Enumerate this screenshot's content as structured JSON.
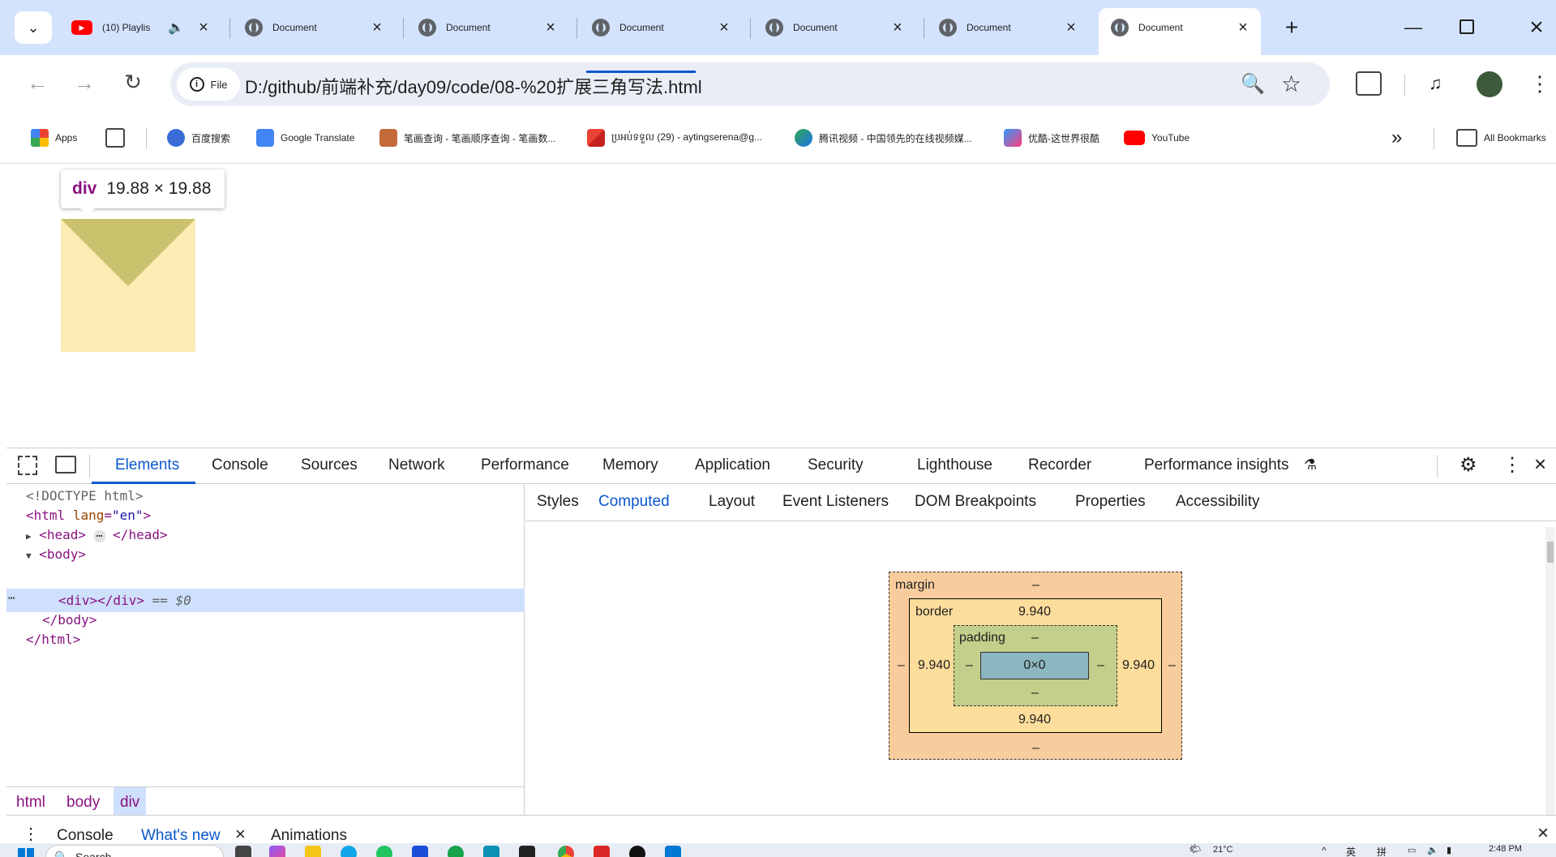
{
  "tabs": [
    {
      "title": "(10) Playlis",
      "icon": "youtube-icon"
    },
    {
      "title": "Document",
      "icon": "globe-icon"
    },
    {
      "title": "Document",
      "icon": "globe-icon"
    },
    {
      "title": "Document",
      "icon": "globe-icon"
    },
    {
      "title": "Document",
      "icon": "globe-icon"
    },
    {
      "title": "Document",
      "icon": "globe-icon"
    },
    {
      "title": "Document",
      "icon": "globe-icon",
      "active": true
    }
  ],
  "toolbar": {
    "file_chip": "File",
    "url": "D:/github/前端补充/day09/code/08-%20扩展三角写法.html"
  },
  "bookmarks": [
    {
      "label": "Apps"
    },
    {
      "label": "百度搜索"
    },
    {
      "label": "Google Translate"
    },
    {
      "label": "笔画查询 - 笔画顺序查询 - 笔画数..."
    },
    {
      "label": "ប្រអប់ទទួល (29) - aytingserena@g..."
    },
    {
      "label": "腾讯视频 - 中国领先的在线视频媒..."
    },
    {
      "label": "优酷-这世界很酷"
    },
    {
      "label": "YouTube"
    },
    {
      "label": "All Bookmarks"
    }
  ],
  "page": {
    "tooltip_tag": "div",
    "tooltip_size": "19.88 × 19.88"
  },
  "devtools": {
    "tabs": [
      "Elements",
      "Console",
      "Sources",
      "Network",
      "Performance",
      "Memory",
      "Application",
      "Security",
      "Lighthouse",
      "Recorder",
      "Performance insights"
    ],
    "selected_tab": "Elements",
    "subtabs": [
      "Styles",
      "Computed",
      "Layout",
      "Event Listeners",
      "DOM Breakpoints",
      "Properties",
      "Accessibility"
    ],
    "selected_subtab": "Computed",
    "dom": {
      "doctype": "<!DOCTYPE html>",
      "html_open": "<html",
      "lang_attr": "lang",
      "lang_val": "\"en\"",
      "html_open_end": ">",
      "head": "<head>",
      "head_ellipsis": "⋯",
      "head_close": "</head>",
      "body_open": "<body>",
      "div": "<div></div>",
      "selected_marker": "== $0",
      "body_close": "</body>",
      "html_close": "</html>",
      "row_dots": "⋯"
    },
    "breadcrumbs": [
      "html",
      "body",
      "div"
    ],
    "box_model": {
      "margin_label": "margin",
      "margin_top": "–",
      "margin_bottom": "–",
      "margin_left": "–",
      "margin_right": "–",
      "border_label": "border",
      "border_top": "9.940",
      "border_bottom": "9.940",
      "border_left": "9.940",
      "border_right": "9.940",
      "padding_label": "padding",
      "padding_top": "–",
      "padding_bottom": "–",
      "padding_left": "–",
      "padding_right": "–",
      "content": "0×0"
    },
    "drawer": {
      "tabs": [
        "Console",
        "What's new",
        "Animations"
      ],
      "selected": "What's new"
    }
  },
  "taskbar": {
    "search_placeholder": "Search",
    "weather": "21°C",
    "time": "2:48 PM",
    "ime1": "英",
    "ime2": "拼"
  },
  "colors": {
    "tabstrip": "#d3e3fd",
    "accent": "#0b57d0",
    "box_fill": "#fdebb5",
    "triangle": "#c9c36e"
  }
}
